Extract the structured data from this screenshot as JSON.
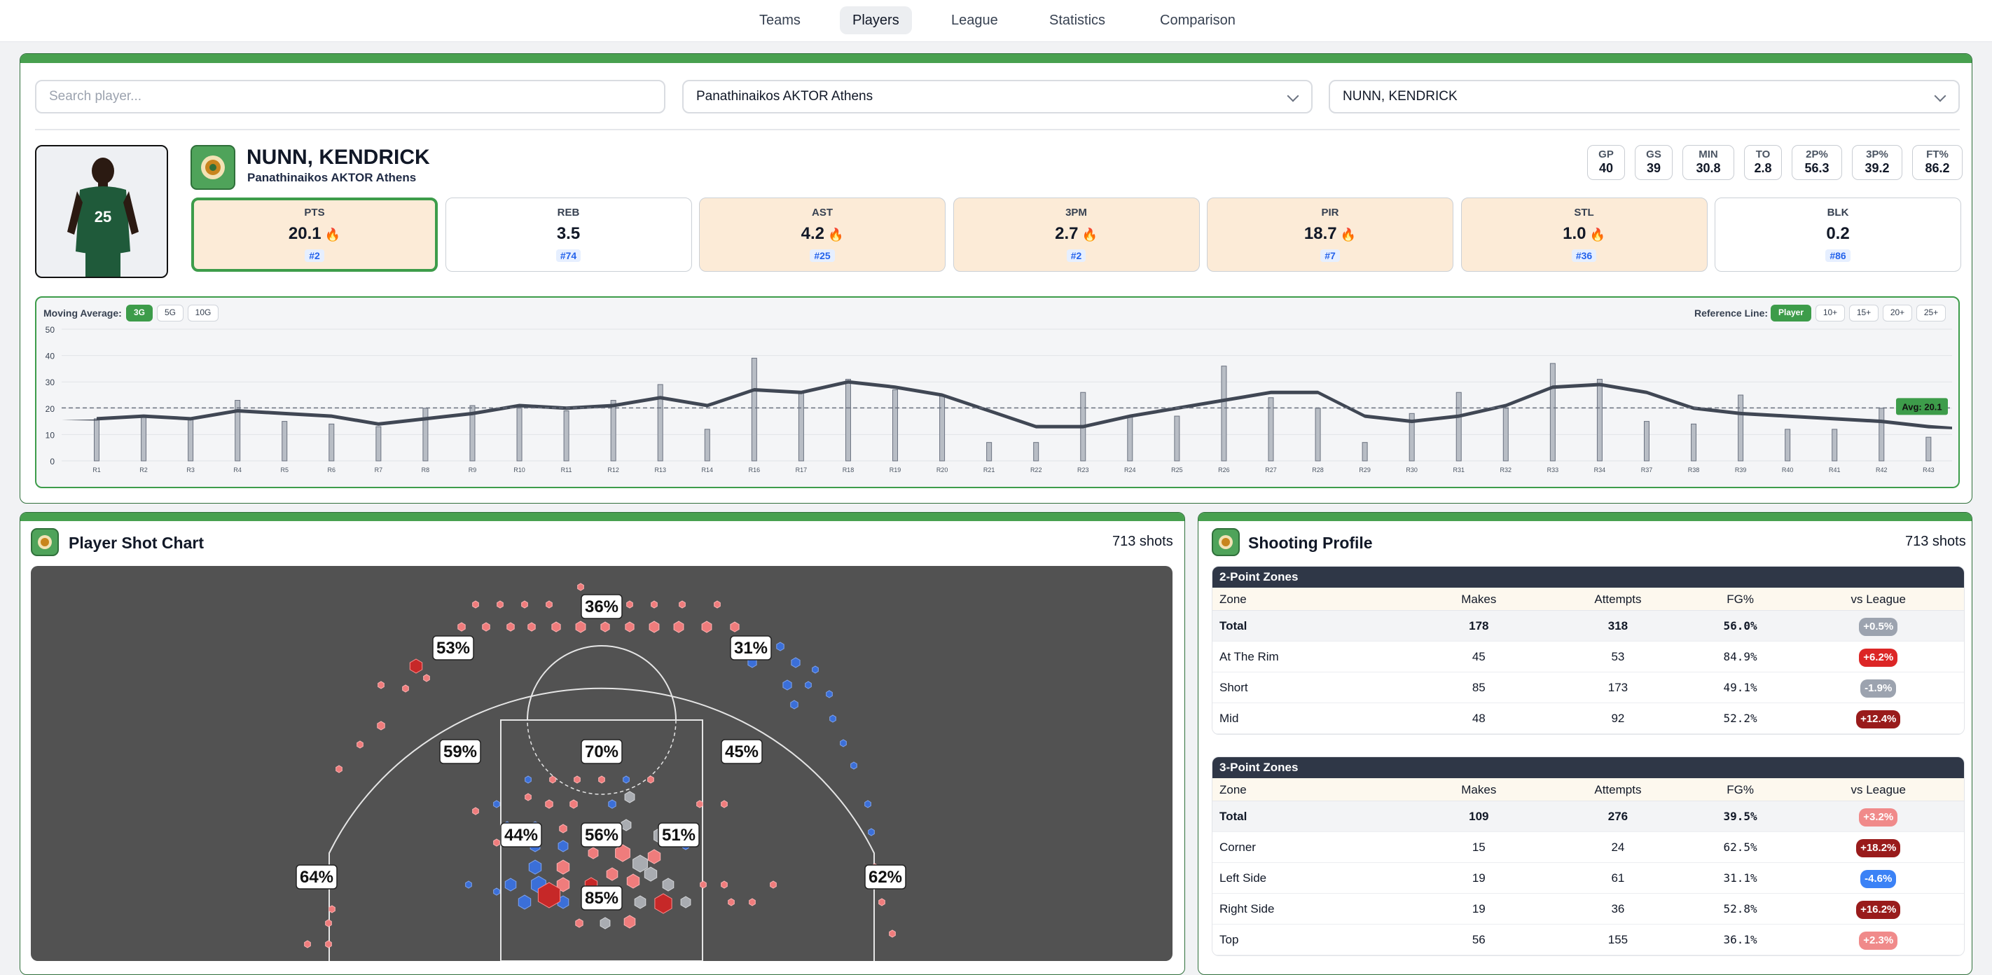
{
  "nav": [
    "Teams",
    "Players",
    "League",
    "Statistics",
    "Comparison"
  ],
  "filters": {
    "search_placeholder": "Search player...",
    "team_select": "Panathinaikos AKTOR Athens",
    "player_select": "NUNN, KENDRICK"
  },
  "player": {
    "name": "NUNN, KENDRICK",
    "team": "Panathinaikos AKTOR Athens",
    "jersey": "25"
  },
  "season_stats": [
    {
      "label": "GP",
      "value": "40"
    },
    {
      "label": "GS",
      "value": "39"
    },
    {
      "label": "MIN",
      "value": "30.8"
    },
    {
      "label": "TO",
      "value": "2.8"
    },
    {
      "label": "2P%",
      "value": "56.3"
    },
    {
      "label": "3P%",
      "value": "39.2"
    },
    {
      "label": "FT%",
      "value": "86.2"
    }
  ],
  "key_stats": [
    {
      "label": "PTS",
      "value": "20.1",
      "rank": "#2",
      "hot": true,
      "selected": true
    },
    {
      "label": "REB",
      "value": "3.5",
      "rank": "#74",
      "hot": false,
      "selected": false
    },
    {
      "label": "AST",
      "value": "4.2",
      "rank": "#25",
      "hot": true,
      "selected": false
    },
    {
      "label": "3PM",
      "value": "2.7",
      "rank": "#2",
      "hot": true,
      "selected": false
    },
    {
      "label": "PIR",
      "value": "18.7",
      "rank": "#7",
      "hot": true,
      "selected": false
    },
    {
      "label": "STL",
      "value": "1.0",
      "rank": "#36",
      "hot": true,
      "selected": false
    },
    {
      "label": "BLK",
      "value": "0.2",
      "rank": "#86",
      "hot": false,
      "selected": false
    }
  ],
  "game_chart": {
    "moving_average_label": "Moving Average:",
    "ma_options": [
      "3G",
      "5G",
      "10G"
    ],
    "ma_active": "3G",
    "reference_label": "Reference Line:",
    "ref_options": [
      "Player",
      "10+",
      "15+",
      "20+",
      "25+"
    ],
    "ref_active": "Player",
    "avg_badge": "Avg: 20.1"
  },
  "chart_data": {
    "type": "bar",
    "categories": [
      "R1",
      "R2",
      "R3",
      "R4",
      "R5",
      "R6",
      "R7",
      "R8",
      "R9",
      "R10",
      "R11",
      "R12",
      "R13",
      "R14",
      "R16",
      "R17",
      "R18",
      "R19",
      "R20",
      "R21",
      "R22",
      "R23",
      "R24",
      "R25",
      "R26",
      "R27",
      "R28",
      "R29",
      "R30",
      "R31",
      "R32",
      "R33",
      "R34",
      "R37",
      "R38",
      "R39",
      "R40",
      "R41",
      "R42",
      "R43"
    ],
    "values": [
      16,
      17,
      16,
      23,
      15,
      14,
      13,
      20,
      21,
      21,
      19,
      23,
      29,
      12,
      39,
      26,
      31,
      27,
      25,
      7,
      7,
      26,
      17,
      17,
      36,
      24,
      20,
      7,
      18,
      26,
      20,
      37,
      31,
      15,
      14,
      25,
      12,
      12,
      20,
      9
    ],
    "moving_average": [
      16,
      17,
      16,
      19,
      18,
      17,
      14,
      16,
      18,
      21,
      20,
      21,
      24,
      21,
      27,
      26,
      30,
      28,
      25,
      19,
      13,
      13,
      17,
      20,
      23,
      26,
      26,
      17,
      15,
      17,
      21,
      28,
      29,
      26,
      20,
      18,
      17,
      16,
      15,
      13
    ],
    "reference_avg": 20.1,
    "ylim": [
      0,
      50
    ],
    "yticks": [
      0,
      10,
      20,
      30,
      40,
      50
    ],
    "grid": true
  },
  "shot_chart": {
    "title": "Player Shot Chart",
    "shots_label": "713 shots",
    "zones": [
      {
        "label": "36%"
      },
      {
        "label": "53%"
      },
      {
        "label": "31%"
      },
      {
        "label": "59%"
      },
      {
        "label": "70%"
      },
      {
        "label": "45%"
      },
      {
        "label": "44%"
      },
      {
        "label": "56%"
      },
      {
        "label": "51%"
      },
      {
        "label": "64%"
      },
      {
        "label": "62%"
      },
      {
        "label": "85%"
      }
    ]
  },
  "shooting_profile": {
    "title": "Shooting Profile",
    "shots_label": "713 shots",
    "two_point": {
      "header": "2-Point Zones",
      "columns": [
        "Zone",
        "Makes",
        "Attempts",
        "FG%",
        "vs League"
      ],
      "rows": [
        {
          "zone": "Total",
          "makes": "178",
          "attempts": "318",
          "fg": "56.0%",
          "vs": "+0.5%",
          "color": "#9ca3af"
        },
        {
          "zone": "At The Rim",
          "makes": "45",
          "attempts": "53",
          "fg": "84.9%",
          "vs": "+6.2%",
          "color": "#dc2626"
        },
        {
          "zone": "Short",
          "makes": "85",
          "attempts": "173",
          "fg": "49.1%",
          "vs": "-1.9%",
          "color": "#9ca3af"
        },
        {
          "zone": "Mid",
          "makes": "48",
          "attempts": "92",
          "fg": "52.2%",
          "vs": "+12.4%",
          "color": "#991b1b"
        }
      ]
    },
    "three_point": {
      "header": "3-Point Zones",
      "columns": [
        "Zone",
        "Makes",
        "Attempts",
        "FG%",
        "vs League"
      ],
      "rows": [
        {
          "zone": "Total",
          "makes": "109",
          "attempts": "276",
          "fg": "39.5%",
          "vs": "+3.2%",
          "color": "#f08a8a"
        },
        {
          "zone": "Corner",
          "makes": "15",
          "attempts": "24",
          "fg": "62.5%",
          "vs": "+18.2%",
          "color": "#991b1b"
        },
        {
          "zone": "Left Side",
          "makes": "19",
          "attempts": "61",
          "fg": "31.1%",
          "vs": "-4.6%",
          "color": "#3b82f6"
        },
        {
          "zone": "Right Side",
          "makes": "19",
          "attempts": "36",
          "fg": "52.8%",
          "vs": "+16.2%",
          "color": "#991b1b"
        },
        {
          "zone": "Top",
          "makes": "56",
          "attempts": "155",
          "fg": "36.1%",
          "vs": "+2.3%",
          "color": "#f08a8a"
        }
      ]
    }
  }
}
